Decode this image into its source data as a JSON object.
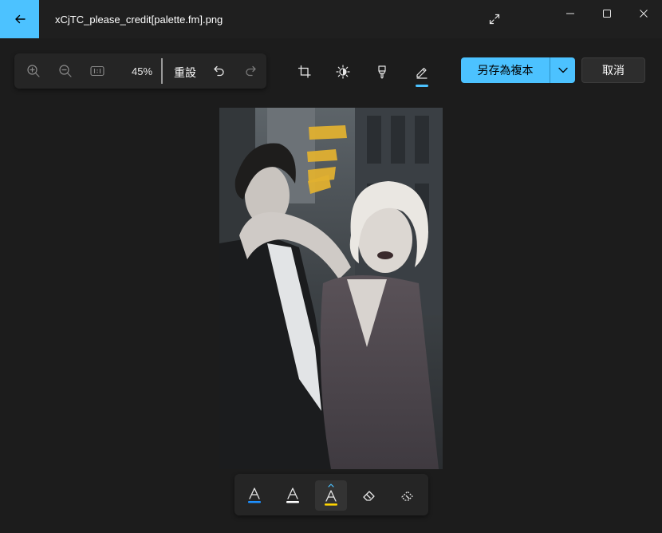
{
  "window": {
    "title": "xCjTC_please_credit[palette.fm].png",
    "back_icon": "arrow-left-icon",
    "expand_icon": "expand-diagonal-icon",
    "controls": [
      "minimize-icon",
      "maximize-icon",
      "close-icon"
    ]
  },
  "toolbar": {
    "zoom_in_icon": "zoom-in-icon",
    "zoom_out_icon": "zoom-out-icon",
    "actual_size_icon": "actual-size-icon",
    "zoom_level": "45%",
    "reset_label": "重設",
    "undo_icon": "undo-icon",
    "redo_icon": "redo-icon"
  },
  "tools": [
    {
      "name": "crop",
      "icon": "crop-icon",
      "active": false
    },
    {
      "name": "adjust",
      "icon": "brightness-icon",
      "active": false
    },
    {
      "name": "filter",
      "icon": "filter-icon",
      "active": false
    },
    {
      "name": "markup",
      "icon": "markup-pen-icon",
      "active": true
    }
  ],
  "actions": {
    "save_copy_label": "另存為複本",
    "save_dropdown_icon": "chevron-down-icon",
    "cancel_label": "取消"
  },
  "markup_tools": [
    {
      "name": "ballpoint-pen",
      "icon": "ballpoint-pen-icon",
      "color": "#1e90ff",
      "selected": false
    },
    {
      "name": "pencil",
      "icon": "pencil-icon",
      "color": "#ffffff",
      "selected": false
    },
    {
      "name": "highlighter",
      "icon": "highlighter-icon",
      "color": "#ffd400",
      "selected": true
    },
    {
      "name": "eraser",
      "icon": "eraser-icon",
      "selected": false
    },
    {
      "name": "erase-all",
      "icon": "erase-all-icon",
      "selected": false
    }
  ],
  "colors": {
    "accent": "#4cc2ff",
    "background": "#1c1c1c",
    "titlebar": "#1f1f1f",
    "panel": "#252525",
    "highlight_stroke": "#e0b030"
  }
}
